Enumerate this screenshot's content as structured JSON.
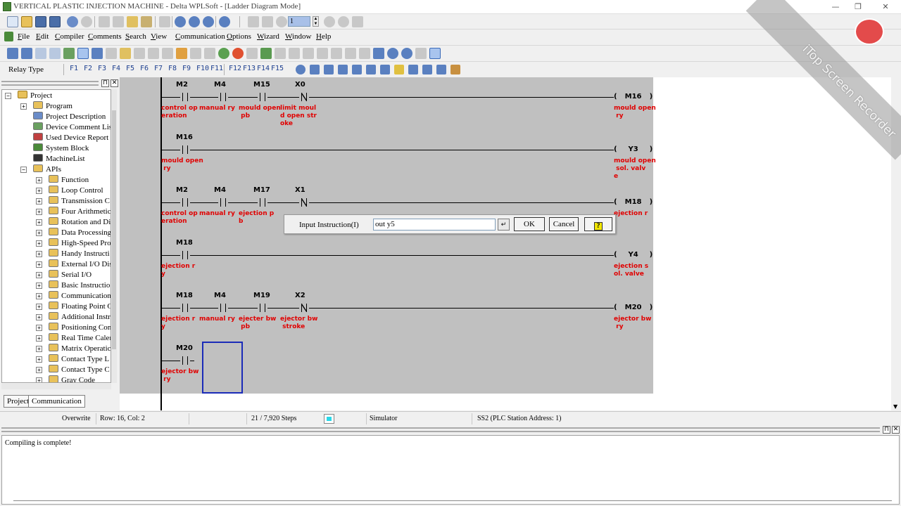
{
  "window": {
    "title": "VERTICAL PLASTIC INJECTION MACHINE - Delta WPLSoft - [Ladder Diagram Mode]",
    "controls": [
      "—",
      "❐",
      "✕"
    ]
  },
  "toolbar1": {
    "step_value": "1"
  },
  "menu": [
    {
      "label": "File",
      "u": "F",
      "rest": "ile"
    },
    {
      "label": "Edit",
      "u": "E",
      "rest": "dit"
    },
    {
      "label": "Compiler",
      "u": "C",
      "rest": "ompiler"
    },
    {
      "label": "Comments",
      "u": "C",
      "rest": "omments"
    },
    {
      "label": "Search",
      "u": "S",
      "rest": "earch"
    },
    {
      "label": "View",
      "u": "V",
      "rest": "iew"
    },
    {
      "label": "Communication",
      "u": "C",
      "rest": "ommunication"
    },
    {
      "label": "Options",
      "u": "O",
      "rest": "ptions"
    },
    {
      "label": "Wizard",
      "u": "W",
      "rest": "izard"
    },
    {
      "label": "Window",
      "u": "W",
      "rest": "indow"
    },
    {
      "label": "Help",
      "u": "H",
      "rest": "elp"
    }
  ],
  "toolbar3": {
    "relay_type_label": "Relay Type",
    "symbols": [
      "F1",
      "F2",
      "F3",
      "F4",
      "F5",
      "F6",
      "F7",
      "F8",
      "F9",
      "F10",
      "F11",
      "F12",
      "F13",
      "F14",
      "F15"
    ]
  },
  "project_tree": {
    "root": "Project",
    "items": [
      {
        "label": "Program",
        "level": 1,
        "expander": "+"
      },
      {
        "label": "Project Description",
        "level": 1
      },
      {
        "label": "Device Comment List",
        "level": 1
      },
      {
        "label": "Used Device Report",
        "level": 1
      },
      {
        "label": "System Block",
        "level": 1
      },
      {
        "label": "MachineList",
        "level": 1
      },
      {
        "label": "APIs",
        "level": 1,
        "expander": "-"
      },
      {
        "label": "Function",
        "level": 2,
        "expander": "+"
      },
      {
        "label": "Loop Control",
        "level": 2,
        "expander": "+"
      },
      {
        "label": "Transmission C",
        "level": 2,
        "expander": "+"
      },
      {
        "label": "Four Arithmetic",
        "level": 2,
        "expander": "+"
      },
      {
        "label": "Rotation and Di",
        "level": 2,
        "expander": "+"
      },
      {
        "label": "Data Processing",
        "level": 2,
        "expander": "+"
      },
      {
        "label": "High-Speed Pro",
        "level": 2,
        "expander": "+"
      },
      {
        "label": "Handy Instructi",
        "level": 2,
        "expander": "+"
      },
      {
        "label": "External I/O Dis",
        "level": 2,
        "expander": "+"
      },
      {
        "label": "Serial I/O",
        "level": 2,
        "expander": "+"
      },
      {
        "label": "Basic Instructio",
        "level": 2,
        "expander": "+"
      },
      {
        "label": "Communication",
        "level": 2,
        "expander": "+"
      },
      {
        "label": "Floating Point C",
        "level": 2,
        "expander": "+"
      },
      {
        "label": "Additional Instr",
        "level": 2,
        "expander": "+"
      },
      {
        "label": "Positioning Con",
        "level": 2,
        "expander": "+"
      },
      {
        "label": "Real Time Caler",
        "level": 2,
        "expander": "+"
      },
      {
        "label": "Matrix Operatic",
        "level": 2,
        "expander": "+"
      },
      {
        "label": "Contact Type L",
        "level": 2,
        "expander": "+"
      },
      {
        "label": "Contact Type C",
        "level": 2,
        "expander": "+"
      },
      {
        "label": "Gray Code",
        "level": 2,
        "expander": "+"
      }
    ],
    "tabs": [
      "Project",
      "Communication"
    ]
  },
  "ladder": {
    "rungs": [
      {
        "contacts": [
          {
            "device": "M2",
            "type": "no",
            "comment": "control op\neration"
          },
          {
            "device": "M4",
            "type": "no",
            "comment": "manual ry"
          },
          {
            "device": "M15",
            "type": "no",
            "comment": "mould open\n pb"
          },
          {
            "device": "X0",
            "type": "nc",
            "comment": "limit moul\nd open str\noke"
          }
        ],
        "coil": "M16",
        "coil_comment": "mould open\n ry"
      },
      {
        "contacts": [
          {
            "device": "M16",
            "type": "no",
            "comment": "mould open\n ry"
          }
        ],
        "coil": "Y3",
        "coil_comment": "mould open\n sol. valv\ne"
      },
      {
        "contacts": [
          {
            "device": "M2",
            "type": "no",
            "comment": "control op\neration"
          },
          {
            "device": "M4",
            "type": "no",
            "comment": "manual ry"
          },
          {
            "device": "M17",
            "type": "no",
            "comment": "ejection p\nb"
          },
          {
            "device": "X1",
            "type": "nc",
            "comment": ""
          }
        ],
        "coil": "M18",
        "coil_comment": "ejection r"
      },
      {
        "contacts": [
          {
            "device": "M18",
            "type": "no",
            "comment": "ejection r\ny"
          }
        ],
        "coil": "Y4",
        "coil_comment": "ejection s\nol. valve"
      },
      {
        "contacts": [
          {
            "device": "M18",
            "type": "no",
            "comment": "ejection r\ny"
          },
          {
            "device": "M4",
            "type": "no",
            "comment": "manual ry"
          },
          {
            "device": "M19",
            "type": "no",
            "comment": "ejecter bw\n pb"
          },
          {
            "device": "X2",
            "type": "nc",
            "comment": "ejector bw\n stroke"
          }
        ],
        "coil": "M20",
        "coil_comment": "ejector bw\n ry"
      },
      {
        "contacts": [
          {
            "device": "M20",
            "type": "no",
            "comment": "ejector bw\n ry"
          }
        ],
        "coil": "",
        "coil_comment": ""
      }
    ]
  },
  "dialog": {
    "label": "Input Instruction(I)",
    "value": "out y5",
    "enter_symbol": "↵",
    "ok": "OK",
    "cancel": "Cancel",
    "help_symbol": "?"
  },
  "statusbar": {
    "mode": "Overwrite",
    "position": "Row: 16, Col: 2",
    "steps": "21 / 7,920 Steps",
    "simulator": "Simulator",
    "station": "SS2 (PLC Station Address: 1)"
  },
  "output": {
    "message": "Compiling is complete!"
  },
  "watermark": "iTop Screen Recorder",
  "colors": {
    "comment_red": "#e00000",
    "ladder_bg": "#c0c0c0",
    "cursor_blue": "#1a2bb8",
    "simulator_cyan": "#29d8e8"
  }
}
